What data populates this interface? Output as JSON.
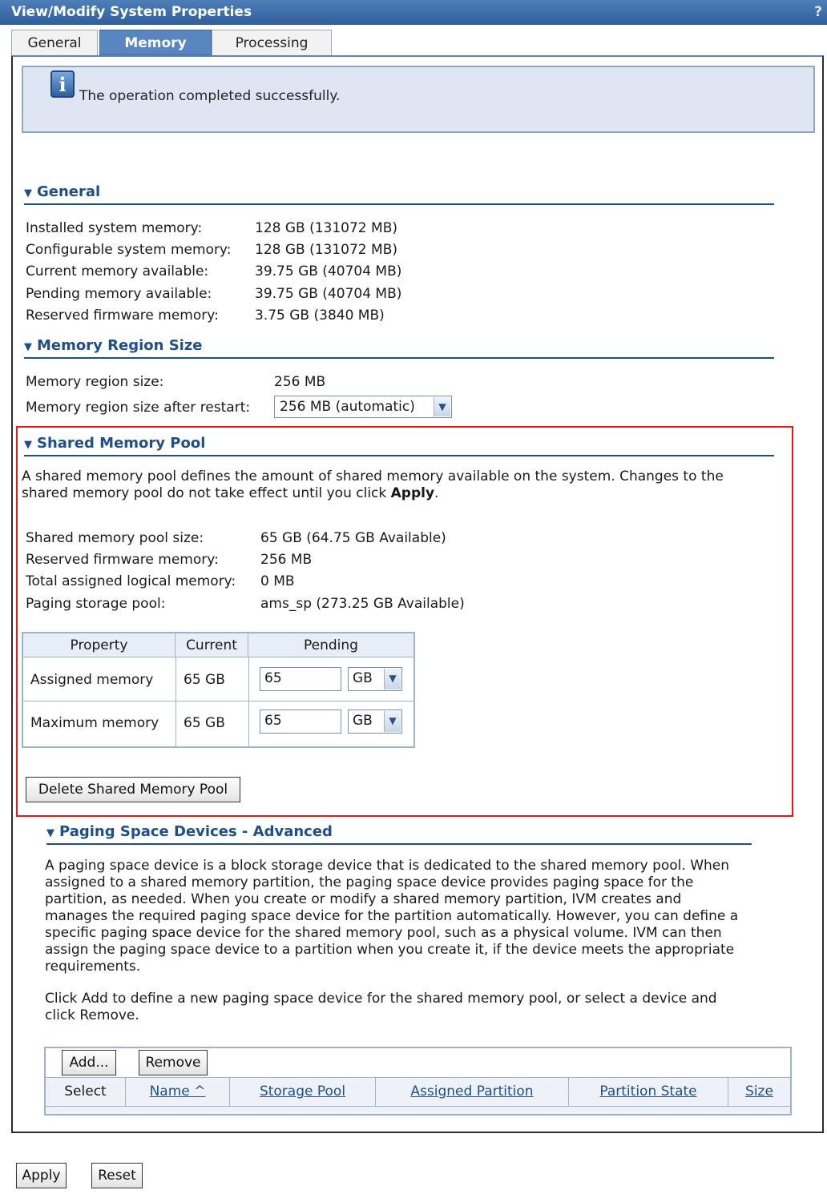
{
  "window": {
    "title": "View/Modify System Properties",
    "help": "?"
  },
  "tabs": [
    {
      "label": "General"
    },
    {
      "label": "Memory"
    },
    {
      "label": "Processing"
    }
  ],
  "message": {
    "text": "The operation completed successfully."
  },
  "general": {
    "heading": "General",
    "rows": [
      {
        "label": "Installed system memory:",
        "value": "128 GB (131072 MB)"
      },
      {
        "label": "Configurable system memory:",
        "value": "128 GB (131072 MB)"
      },
      {
        "label": "Current memory available:",
        "value": "39.75 GB (40704 MB)"
      },
      {
        "label": "Pending memory available:",
        "value": "39.75 GB (40704 MB)"
      },
      {
        "label": "Reserved firmware memory:",
        "value": "3.75 GB (3840 MB)"
      }
    ]
  },
  "region": {
    "heading": "Memory Region Size",
    "size_label": "Memory region size:",
    "size_value": "256 MB",
    "restart_label": "Memory region size after restart:",
    "restart_value": "256 MB (automatic)"
  },
  "shared": {
    "heading": "Shared Memory Pool",
    "desc_1": "A shared memory pool defines the amount of shared memory available on the system. Changes to the",
    "desc_2a": "shared memory pool do not take effect until you click ",
    "desc_2b": "Apply",
    "desc_2c": ".",
    "rows": [
      {
        "label": "Shared memory pool size:",
        "value": "65 GB (64.75 GB Available)"
      },
      {
        "label": "Reserved firmware memory:",
        "value": "256 MB"
      },
      {
        "label": "Total assigned logical memory:",
        "value": "0 MB"
      },
      {
        "label": "Paging storage pool:",
        "value": "ams_sp (273.25 GB Available)"
      }
    ],
    "table": {
      "headers": [
        "Property",
        "Current",
        "Pending"
      ],
      "rows": [
        {
          "property": "Assigned memory",
          "current": "65 GB",
          "pending": "65",
          "unit": "GB"
        },
        {
          "property": "Maximum memory",
          "current": "65 GB",
          "pending": "65",
          "unit": "GB"
        }
      ]
    },
    "delete_label": "Delete Shared Memory Pool"
  },
  "paging": {
    "heading": "Paging Space Devices - Advanced",
    "para1": [
      "A paging space device is a block storage device that is dedicated to the shared memory pool. When",
      "assigned to a shared memory partition, the paging space device provides paging space for the",
      "partition, as needed. When you create or modify a shared memory partition, IVM creates and",
      "manages the required paging space device for the partition automatically. However, you can define a",
      "specific paging space device for the shared memory pool, such as a physical volume. IVM can then",
      "assign the paging space device to a partition when you create it, if the device meets the appropriate",
      "requirements."
    ],
    "para2": [
      "Click Add to define a new paging space device for the shared memory pool, or select a device and",
      "click Remove."
    ],
    "add_label": "Add...",
    "remove_label": "Remove",
    "columns": [
      "Select",
      "Name ^",
      "Storage Pool",
      "Assigned Partition",
      "Partition State",
      "Size"
    ]
  },
  "footer": {
    "apply_label": "Apply",
    "reset_label": "Reset"
  }
}
